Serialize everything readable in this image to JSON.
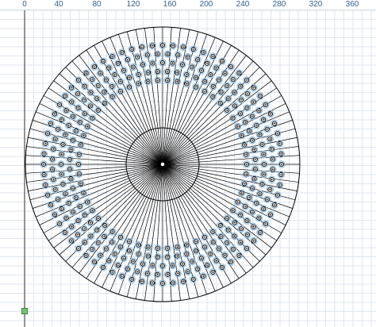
{
  "ruler": {
    "labels": [
      "0",
      "40",
      "80",
      "120",
      "160",
      "200",
      "240",
      "280",
      "320",
      "360"
    ]
  },
  "colors": {
    "grid_line": "#dfe6ee",
    "ruler_text": "#2f5f8f",
    "drawing_stroke": "#000000",
    "dot_ring": "#86b8e2",
    "handle": "#6fc46f"
  },
  "icons": {
    "anchor": "square-handle-icon",
    "center": "center-point-icon"
  }
}
